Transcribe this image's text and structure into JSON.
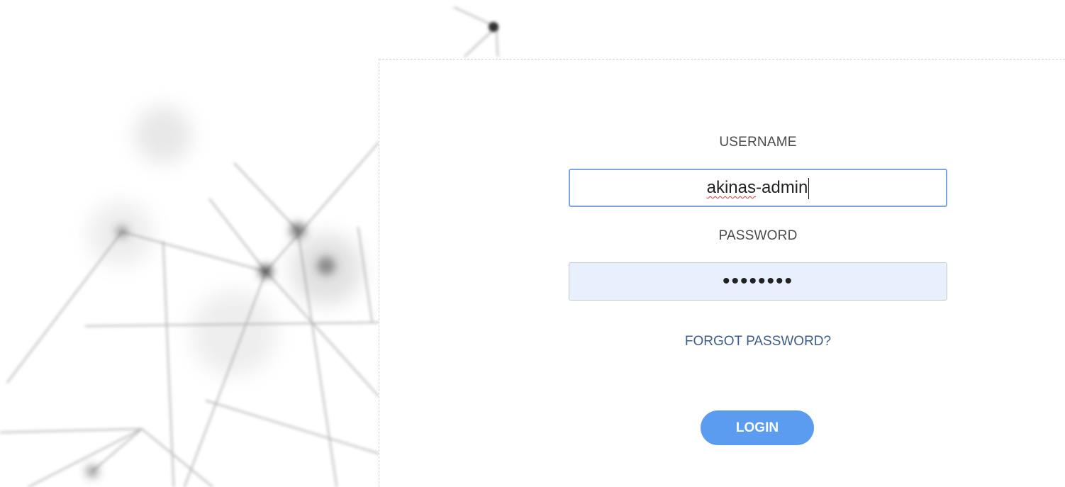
{
  "login_form": {
    "username_label": "USERNAME",
    "username_value": "akinas-admin",
    "username_value_misspelled_part": "akinas",
    "username_value_rest": "-admin",
    "password_label": "PASSWORD",
    "password_masked": "••••••••",
    "forgot_password_label": "FORGOT PASSWORD?",
    "login_button_label": "LOGIN"
  },
  "colors": {
    "accent": "#5b9cf0",
    "link": "#3c5d8a",
    "autofill_background": "#e8f0fe",
    "focus_border": "#7fa3db"
  }
}
